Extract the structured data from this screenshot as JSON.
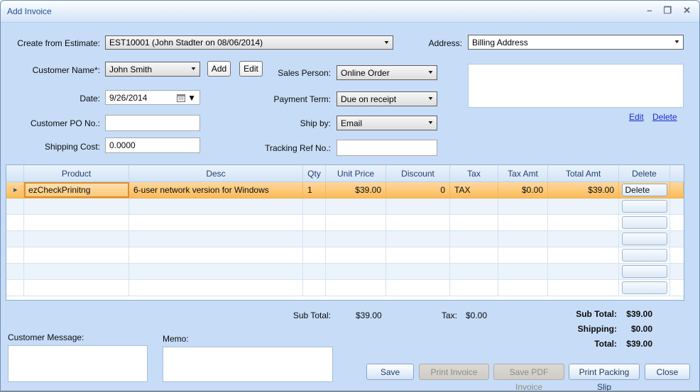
{
  "window": {
    "title": "Add Invoice",
    "minimize_glyph": "–",
    "maximize_glyph": "❒",
    "close_glyph": "✕"
  },
  "form": {
    "create_from_estimate": {
      "label": "Create from Estimate:",
      "value": "EST10001 (John Stadter on 08/06/2014)"
    },
    "customer_name": {
      "label": "Customer Name*:",
      "value": "John Smith",
      "add_button": "Add",
      "edit_button": "Edit"
    },
    "date": {
      "label": "Date:",
      "value": "9/26/2014"
    },
    "customer_po": {
      "label": "Customer PO No.:",
      "value": ""
    },
    "shipping_cost": {
      "label": "Shipping Cost:",
      "value": "0.0000"
    },
    "sales_person": {
      "label": "Sales Person:",
      "value": "Online Order"
    },
    "payment_term": {
      "label": "Payment Term:",
      "value": "Due on receipt"
    },
    "ship_by": {
      "label": "Ship by:",
      "value": "Email"
    },
    "tracking_ref": {
      "label": "Tracking Ref No.:",
      "value": ""
    },
    "address": {
      "label": "Address:",
      "value": "Billing Address",
      "edit_link": "Edit",
      "delete_link": "Delete",
      "text": ""
    }
  },
  "grid": {
    "columns": [
      "Product",
      "Desc",
      "Qty",
      "Unit Price",
      "Discount",
      "Tax",
      "Tax Amt",
      "Total Amt",
      "Delete"
    ],
    "rows": [
      {
        "product": "ezCheckPrinitng",
        "desc": "6-user network version for Windows",
        "qty": "1",
        "unit_price": "$39.00",
        "discount": "0",
        "tax": "TAX",
        "tax_amt": "$0.00",
        "total_amt": "$39.00",
        "delete_label": "Delete"
      }
    ],
    "empty_row_count": 6
  },
  "totals": {
    "sub_total_label": "Sub Total:",
    "sub_total_value": "$39.00",
    "tax_label": "Tax:",
    "tax_value": "$0.00",
    "summary": [
      {
        "label": "Sub Total:",
        "value": "$39.00"
      },
      {
        "label": "Shipping:",
        "value": "$0.00"
      },
      {
        "label": "Total:",
        "value": "$39.00"
      }
    ]
  },
  "bottom": {
    "customer_message_label": "Customer Message:",
    "memo_label": "Memo:",
    "buttons": [
      {
        "label": "Save",
        "enabled": true
      },
      {
        "label": "Print Invoice",
        "enabled": false
      },
      {
        "label": "Save PDF Invoice",
        "enabled": false
      },
      {
        "label": "Print Packing Slip",
        "enabled": true
      },
      {
        "label": "Close",
        "enabled": true
      }
    ]
  },
  "colors": {
    "selection_orange": "#FBBB56",
    "selected_cell_border": "#E28B28",
    "accent_blue": "#1F4E9C",
    "link_blue": "#1B2ECF",
    "body_blue": "#C7DCF7"
  }
}
